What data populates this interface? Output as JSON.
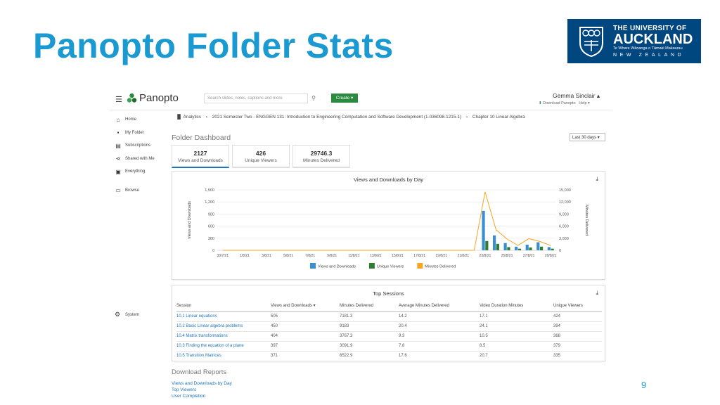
{
  "slide": {
    "title": "Panopto Folder Stats",
    "page_number": "9",
    "logo": {
      "line1": "THE UNIVERSITY OF",
      "line2": "AUCKLAND",
      "line3": "Te Whare Wānanga o Tāmaki Makaurau",
      "line4": "NEW ZEALAND"
    }
  },
  "app": {
    "brand": "Panopto",
    "search_placeholder": "Search slides, notes, captions and more",
    "create_label": "Create ▾",
    "user_name": "Gemma Sinclair ▴",
    "download_link": "Download Panopto",
    "help_link": "Help ▾"
  },
  "sidebar": {
    "items": [
      {
        "label": "Home",
        "icon": "home-icon",
        "glyph": "⌂"
      },
      {
        "label": "My Folder",
        "icon": "folder-icon",
        "glyph": "▪"
      },
      {
        "label": "Subscriptions",
        "icon": "subscriptions-icon",
        "glyph": "▤"
      },
      {
        "label": "Shared with Me",
        "icon": "share-icon",
        "glyph": "⋖"
      },
      {
        "label": "Everything",
        "icon": "everything-icon",
        "glyph": "▣"
      }
    ],
    "browse": "Browse",
    "system": "System"
  },
  "breadcrumb": {
    "analytics": "Analytics",
    "course": "2021 Semester Two - ENGGEN 131: Introduction to Engineering Computation and Software Development (1-036098-1215-1)",
    "chapter": "Chapter 10 Linear Algebra"
  },
  "dashboard": {
    "title": "Folder Dashboard",
    "range": "Last 30 days ▾",
    "stats": [
      {
        "value": "2127",
        "label": "Views and Downloads"
      },
      {
        "value": "426",
        "label": "Unique Viewers"
      },
      {
        "value": "29746.3",
        "label": "Minutes Delivered"
      }
    ]
  },
  "chart_data": {
    "type": "bar",
    "title": "Views and Downloads by Day",
    "ylabel": "Views and Downloads",
    "y2label": "Minutes Delivered",
    "ylim": [
      0,
      1500
    ],
    "y2lim": [
      0,
      15000
    ],
    "yticks": [
      "0",
      "300",
      "600",
      "900",
      "1,200",
      "1,500"
    ],
    "y2ticks": [
      "0",
      "3,000",
      "6,000",
      "9,000",
      "12,000",
      "15,000"
    ],
    "xtick_labels": [
      "30/7/21",
      "1/8/21",
      "3/8/21",
      "5/8/21",
      "7/8/21",
      "9/8/21",
      "11/8/21",
      "13/8/21",
      "15/8/21",
      "17/8/21",
      "19/8/21",
      "21/8/21",
      "23/8/21",
      "25/8/21",
      "27/8/21",
      "29/8/21"
    ],
    "categories": [
      "30/7/21",
      "31/7/21",
      "1/8/21",
      "2/8/21",
      "3/8/21",
      "4/8/21",
      "5/8/21",
      "6/8/21",
      "7/8/21",
      "8/8/21",
      "9/8/21",
      "10/8/21",
      "11/8/21",
      "12/8/21",
      "13/8/21",
      "14/8/21",
      "15/8/21",
      "16/8/21",
      "17/8/21",
      "18/8/21",
      "19/8/21",
      "20/8/21",
      "21/8/21",
      "22/8/21",
      "23/8/21",
      "24/8/21",
      "25/8/21",
      "26/8/21",
      "27/8/21",
      "28/8/21",
      "29/8/21"
    ],
    "series": [
      {
        "name": "Views and Downloads",
        "color": "#3b8fd0",
        "axis": "left",
        "values": [
          0,
          0,
          0,
          0,
          0,
          0,
          0,
          0,
          0,
          0,
          0,
          0,
          0,
          0,
          0,
          0,
          0,
          0,
          0,
          0,
          0,
          0,
          0,
          0,
          980,
          370,
          180,
          90,
          140,
          200,
          80
        ]
      },
      {
        "name": "Unique Viewers",
        "color": "#2e7d32",
        "axis": "left",
        "values": [
          0,
          0,
          0,
          0,
          0,
          0,
          0,
          0,
          0,
          0,
          0,
          0,
          0,
          0,
          0,
          0,
          0,
          0,
          0,
          0,
          0,
          0,
          0,
          0,
          230,
          160,
          80,
          40,
          70,
          90,
          40
        ]
      },
      {
        "name": "Minutes Delivered",
        "color": "#f5a623",
        "axis": "right",
        "kind": "line",
        "values": [
          0,
          0,
          0,
          0,
          0,
          0,
          0,
          0,
          0,
          0,
          0,
          0,
          0,
          0,
          0,
          0,
          0,
          0,
          0,
          0,
          0,
          0,
          0,
          0,
          14500,
          5100,
          2800,
          1200,
          2900,
          2200,
          1200
        ]
      }
    ]
  },
  "top_sessions": {
    "title": "Top Sessions",
    "columns": [
      "Session",
      "Views and Downloads ▾",
      "Minutes Delivered",
      "Average Minutes Delivered",
      "Video Duration Minutes",
      "Unique Viewers"
    ],
    "rows": [
      [
        "10.1 Linear equations",
        "505",
        "7181.3",
        "14.2",
        "17.1",
        "424"
      ],
      [
        "10.2 Basic Linear algebra problems",
        "450",
        "9183",
        "20.4",
        "24.1",
        "394"
      ],
      [
        "10.4 Matrix transformations",
        "404",
        "3767.3",
        "9.3",
        "10.5",
        "368"
      ],
      [
        "10.3 Finding the equation of a plane",
        "397",
        "3091.9",
        "7.8",
        "8.5",
        "379"
      ],
      [
        "10.5 Transition Matrices",
        "371",
        "6522.9",
        "17.6",
        "20.7",
        "335"
      ]
    ]
  },
  "reports": {
    "title": "Download Reports",
    "links": [
      "Views and Downloads by Day",
      "Top Viewers",
      "User Completion"
    ]
  }
}
